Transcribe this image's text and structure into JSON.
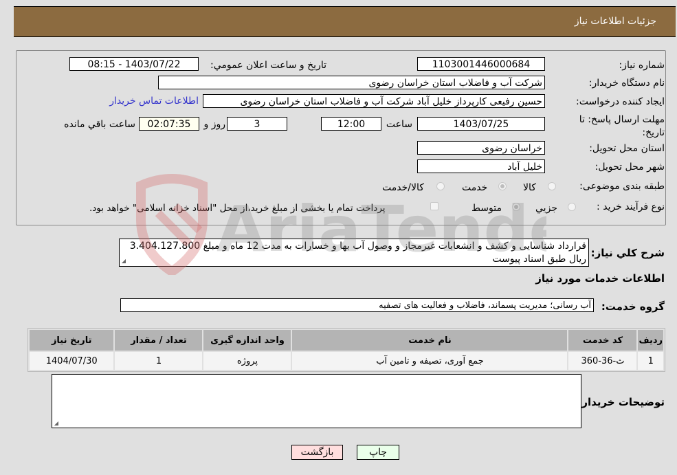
{
  "header": {
    "title": "جزئیات اطلاعات نیاز"
  },
  "fields": {
    "need_number_label": "شماره نیاز:",
    "need_number": "1103001446000684",
    "announce_label": "تاریخ و ساعت اعلان عمومي:",
    "announce_value": "1403/07/22 - 08:15",
    "buyer_org_label": "نام دستگاه خریدار:",
    "buyer_org": "شرکت آب و فاضلاب استان خراسان رضوی",
    "requester_label": "ایجاد کننده درخواست:",
    "requester": "حسین رفیعی کارپرداز خلیل آباد  شرکت آب و فاضلاب استان خراسان رضوی",
    "contact_link": "اطلاعات تماس خریدار",
    "deadline_label": "مهلت ارسال پاسخ: تا تاریخ:",
    "deadline_date": "1403/07/25",
    "time_label": "ساعت",
    "deadline_time": "12:00",
    "days": "3",
    "days_label": "روز و",
    "remaining": "02:07:35",
    "remaining_label": "ساعت باقي مانده",
    "province_label": "استان محل تحویل:",
    "province": "خراسان رضوی",
    "city_label": "شهر محل تحویل:",
    "city": "خلیل آباد",
    "category_label": "طبقه بندی موضوعی:",
    "category_options": [
      {
        "label": "کالا",
        "selected": false
      },
      {
        "label": "خدمت",
        "selected": true
      },
      {
        "label": "کالا/خدمت",
        "selected": false
      }
    ],
    "process_label": "نوع فرآیند خرید :",
    "process_options": [
      {
        "label": "جزيي",
        "selected": false
      },
      {
        "label": "متوسط",
        "selected": true
      }
    ],
    "treasury_note": "پرداخت تمام یا بخشی از مبلغ خرید،از محل \"اسناد خزانه اسلامی\" خواهد بود."
  },
  "description": {
    "label": "شرح کلي نیاز:",
    "text": "قرارداد شناسایی و کشف و انشعابات غیرمجاز و وصول آب بها و خسارات به مدت 12 ماه و مبلغ 3.404.127.800 ریال طبق اسناد پیوست"
  },
  "services": {
    "section_title": "اطلاعات خدمات مورد نیاز",
    "group_label": "گروه خدمت:",
    "group_value": "آب رسانی؛ مدیریت پسماند، فاضلاب و فعالیت های تصفیه",
    "columns": [
      "ردیف",
      "کد خدمت",
      "نام خدمت",
      "واحد اندازه گیری",
      "تعداد / مقدار",
      "تاریخ نیاز"
    ],
    "rows": [
      [
        "1",
        "ث-36-360",
        "جمع آوری، تصیفه و تامین آب",
        "پروژه",
        "1",
        "1404/07/30"
      ]
    ]
  },
  "buyer_notes": {
    "label": "توضیحات خریدار:",
    "value": ""
  },
  "buttons": {
    "print": "چاپ",
    "back": "بازگشت"
  },
  "watermark": {
    "text": "AriaTender.neT"
  },
  "colors": {
    "header_bg": "#8c6b40",
    "print_bg": "#eaffea",
    "back_bg": "#ffdede",
    "link": "#3333cc"
  }
}
